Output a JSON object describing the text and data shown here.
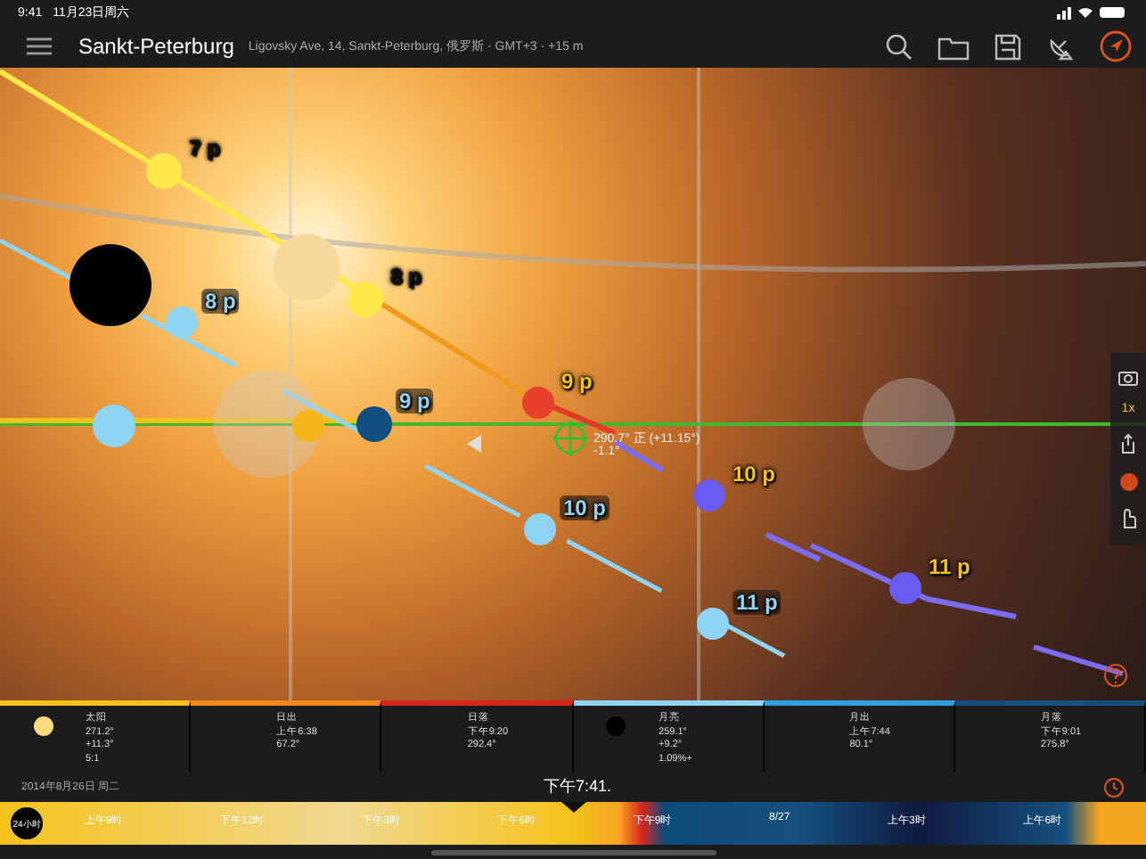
{
  "status_bar": {
    "time": "9:41",
    "date": "11月23日周六"
  },
  "header": {
    "title": "Sankt-Peterburg",
    "subtitle": "Ligovsky Ave, 14, Sankt-Peterburg, 俄罗斯 · GMT+3 · +15 m"
  },
  "markers": [
    {
      "kind": "sun",
      "label": "7 p"
    },
    {
      "kind": "sun",
      "label": "8 p"
    },
    {
      "kind": "sunset",
      "label": "9 p"
    },
    {
      "kind": "moon",
      "label": "8 p"
    },
    {
      "kind": "moon-dark",
      "label": "9 p"
    },
    {
      "kind": "moon",
      "label": "10 p"
    },
    {
      "kind": "moon",
      "label": "11 p"
    },
    {
      "kind": "purple",
      "label": "10 p"
    },
    {
      "kind": "purple",
      "label": "11 p"
    }
  ],
  "reading": {
    "bearing": "290.7° 正 (+11.15°)",
    "elevation": "-1.1°"
  },
  "side_tools": {
    "zoom": "1x"
  },
  "info_panels": [
    {
      "kind": "sun",
      "color": "#f5c21b",
      "title": "太阳",
      "lines": [
        "271.2°",
        "+11.3°",
        "5:1"
      ]
    },
    {
      "kind": "plain",
      "color": "#f08a1c",
      "title": "日出",
      "lines": [
        "上午6:38",
        "67.2°"
      ]
    },
    {
      "kind": "plain",
      "color": "#d8261f",
      "title": "日落",
      "lines": [
        "下午9:20",
        "292.4°"
      ]
    },
    {
      "kind": "moon",
      "color": "#8fd3f5",
      "title": "月亮",
      "lines": [
        "259.1°",
        "+9.2°",
        "1.09%+"
      ]
    },
    {
      "kind": "plain",
      "color": "#2f9fe0",
      "title": "月出",
      "lines": [
        "上午7:44",
        "80.1°"
      ]
    },
    {
      "kind": "plain",
      "color": "#15507e",
      "title": "月落",
      "lines": [
        "下午9:01",
        "275.8°"
      ]
    }
  ],
  "date": "2014年8月26日 周二",
  "time": "下午7:41.",
  "timeline": {
    "badge": "24小时",
    "ticks": [
      "上午9时",
      "下午12时",
      "下午3时",
      "下午6时",
      "下午9时",
      "8/27",
      "上午3时",
      "上午6时"
    ]
  }
}
